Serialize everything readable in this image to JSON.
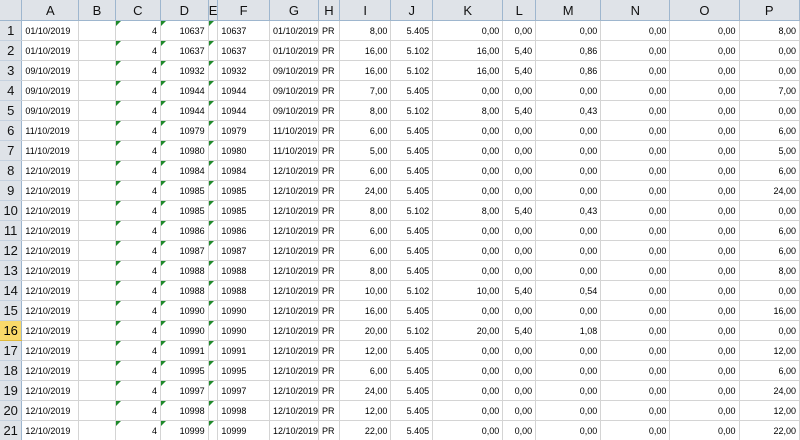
{
  "sheet": {
    "columns": [
      "A",
      "B",
      "C",
      "D",
      "E",
      "F",
      "G",
      "H",
      "I",
      "J",
      "K",
      "L",
      "M",
      "N",
      "O",
      "P"
    ],
    "rows": [
      {
        "n": "1",
        "a": "01/10/2019",
        "c": "4",
        "d": "10637",
        "f": "10637",
        "g": "01/10/2019",
        "h": "PR",
        "i": "8,00",
        "j": "5.405",
        "k": "0,00",
        "l": "0,00",
        "m": "0,00",
        "nn": "0,00",
        "o": "0,00",
        "p": "8,00"
      },
      {
        "n": "2",
        "a": "01/10/2019",
        "c": "4",
        "d": "10637",
        "f": "10637",
        "g": "01/10/2019",
        "h": "PR",
        "i": "16,00",
        "j": "5.102",
        "k": "16,00",
        "l": "5,40",
        "m": "0,86",
        "nn": "0,00",
        "o": "0,00",
        "p": "0,00"
      },
      {
        "n": "3",
        "a": "09/10/2019",
        "c": "4",
        "d": "10932",
        "f": "10932",
        "g": "09/10/2019",
        "h": "PR",
        "i": "16,00",
        "j": "5.102",
        "k": "16,00",
        "l": "5,40",
        "m": "0,86",
        "nn": "0,00",
        "o": "0,00",
        "p": "0,00"
      },
      {
        "n": "4",
        "a": "09/10/2019",
        "c": "4",
        "d": "10944",
        "f": "10944",
        "g": "09/10/2019",
        "h": "PR",
        "i": "7,00",
        "j": "5.405",
        "k": "0,00",
        "l": "0,00",
        "m": "0,00",
        "nn": "0,00",
        "o": "0,00",
        "p": "7,00"
      },
      {
        "n": "5",
        "a": "09/10/2019",
        "c": "4",
        "d": "10944",
        "f": "10944",
        "g": "09/10/2019",
        "h": "PR",
        "i": "8,00",
        "j": "5.102",
        "k": "8,00",
        "l": "5,40",
        "m": "0,43",
        "nn": "0,00",
        "o": "0,00",
        "p": "0,00"
      },
      {
        "n": "6",
        "a": "11/10/2019",
        "c": "4",
        "d": "10979",
        "f": "10979",
        "g": "11/10/2019",
        "h": "PR",
        "i": "6,00",
        "j": "5.405",
        "k": "0,00",
        "l": "0,00",
        "m": "0,00",
        "nn": "0,00",
        "o": "0,00",
        "p": "6,00"
      },
      {
        "n": "7",
        "a": "11/10/2019",
        "c": "4",
        "d": "10980",
        "f": "10980",
        "g": "11/10/2019",
        "h": "PR",
        "i": "5,00",
        "j": "5.405",
        "k": "0,00",
        "l": "0,00",
        "m": "0,00",
        "nn": "0,00",
        "o": "0,00",
        "p": "5,00"
      },
      {
        "n": "8",
        "a": "12/10/2019",
        "c": "4",
        "d": "10984",
        "f": "10984",
        "g": "12/10/2019",
        "h": "PR",
        "i": "6,00",
        "j": "5.405",
        "k": "0,00",
        "l": "0,00",
        "m": "0,00",
        "nn": "0,00",
        "o": "0,00",
        "p": "6,00"
      },
      {
        "n": "9",
        "a": "12/10/2019",
        "c": "4",
        "d": "10985",
        "f": "10985",
        "g": "12/10/2019",
        "h": "PR",
        "i": "24,00",
        "j": "5.405",
        "k": "0,00",
        "l": "0,00",
        "m": "0,00",
        "nn": "0,00",
        "o": "0,00",
        "p": "24,00"
      },
      {
        "n": "10",
        "a": "12/10/2019",
        "c": "4",
        "d": "10985",
        "f": "10985",
        "g": "12/10/2019",
        "h": "PR",
        "i": "8,00",
        "j": "5.102",
        "k": "8,00",
        "l": "5,40",
        "m": "0,43",
        "nn": "0,00",
        "o": "0,00",
        "p": "0,00"
      },
      {
        "n": "11",
        "a": "12/10/2019",
        "c": "4",
        "d": "10986",
        "f": "10986",
        "g": "12/10/2019",
        "h": "PR",
        "i": "6,00",
        "j": "5.405",
        "k": "0,00",
        "l": "0,00",
        "m": "0,00",
        "nn": "0,00",
        "o": "0,00",
        "p": "6,00"
      },
      {
        "n": "12",
        "a": "12/10/2019",
        "c": "4",
        "d": "10987",
        "f": "10987",
        "g": "12/10/2019",
        "h": "PR",
        "i": "6,00",
        "j": "5.405",
        "k": "0,00",
        "l": "0,00",
        "m": "0,00",
        "nn": "0,00",
        "o": "0,00",
        "p": "6,00"
      },
      {
        "n": "13",
        "a": "12/10/2019",
        "c": "4",
        "d": "10988",
        "f": "10988",
        "g": "12/10/2019",
        "h": "PR",
        "i": "8,00",
        "j": "5.405",
        "k": "0,00",
        "l": "0,00",
        "m": "0,00",
        "nn": "0,00",
        "o": "0,00",
        "p": "8,00"
      },
      {
        "n": "14",
        "a": "12/10/2019",
        "c": "4",
        "d": "10988",
        "f": "10988",
        "g": "12/10/2019",
        "h": "PR",
        "i": "10,00",
        "j": "5.102",
        "k": "10,00",
        "l": "5,40",
        "m": "0,54",
        "nn": "0,00",
        "o": "0,00",
        "p": "0,00"
      },
      {
        "n": "15",
        "a": "12/10/2019",
        "c": "4",
        "d": "10990",
        "f": "10990",
        "g": "12/10/2019",
        "h": "PR",
        "i": "16,00",
        "j": "5.405",
        "k": "0,00",
        "l": "0,00",
        "m": "0,00",
        "nn": "0,00",
        "o": "0,00",
        "p": "16,00"
      },
      {
        "n": "16",
        "a": "12/10/2019",
        "c": "4",
        "d": "10990",
        "f": "10990",
        "g": "12/10/2019",
        "h": "PR",
        "i": "20,00",
        "j": "5.102",
        "k": "20,00",
        "l": "5,40",
        "m": "1,08",
        "nn": "0,00",
        "o": "0,00",
        "p": "0,00"
      },
      {
        "n": "17",
        "a": "12/10/2019",
        "c": "4",
        "d": "10991",
        "f": "10991",
        "g": "12/10/2019",
        "h": "PR",
        "i": "12,00",
        "j": "5.405",
        "k": "0,00",
        "l": "0,00",
        "m": "0,00",
        "nn": "0,00",
        "o": "0,00",
        "p": "12,00"
      },
      {
        "n": "18",
        "a": "12/10/2019",
        "c": "4",
        "d": "10995",
        "f": "10995",
        "g": "12/10/2019",
        "h": "PR",
        "i": "6,00",
        "j": "5.405",
        "k": "0,00",
        "l": "0,00",
        "m": "0,00",
        "nn": "0,00",
        "o": "0,00",
        "p": "6,00"
      },
      {
        "n": "19",
        "a": "12/10/2019",
        "c": "4",
        "d": "10997",
        "f": "10997",
        "g": "12/10/2019",
        "h": "PR",
        "i": "24,00",
        "j": "5.405",
        "k": "0,00",
        "l": "0,00",
        "m": "0,00",
        "nn": "0,00",
        "o": "0,00",
        "p": "24,00"
      },
      {
        "n": "20",
        "a": "12/10/2019",
        "c": "4",
        "d": "10998",
        "f": "10998",
        "g": "12/10/2019",
        "h": "PR",
        "i": "12,00",
        "j": "5.405",
        "k": "0,00",
        "l": "0,00",
        "m": "0,00",
        "nn": "0,00",
        "o": "0,00",
        "p": "12,00"
      },
      {
        "n": "21",
        "a": "12/10/2019",
        "c": "4",
        "d": "10999",
        "f": "10999",
        "g": "12/10/2019",
        "h": "PR",
        "i": "22,00",
        "j": "5.405",
        "k": "0,00",
        "l": "0,00",
        "m": "0,00",
        "nn": "0,00",
        "o": "0,00",
        "p": "22,00"
      }
    ],
    "active_row": "16"
  },
  "colors": {
    "header_bg": "#dfe3e8",
    "active_row_header": "#f9d96a",
    "gridline": "#d4d4d4",
    "error_triangle": "#1e8a2a"
  }
}
